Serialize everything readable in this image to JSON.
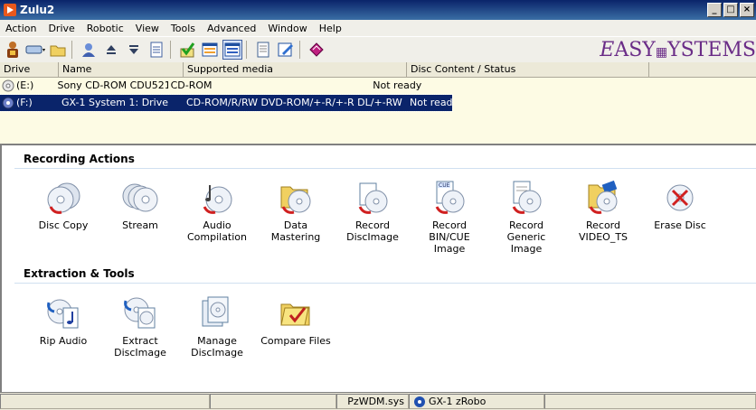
{
  "window": {
    "title": "Zulu2",
    "minimize": "_",
    "maximize": "□",
    "close": "×"
  },
  "menu": [
    "Action",
    "Drive",
    "Robotic",
    "View",
    "Tools",
    "Advanced",
    "Window",
    "Help"
  ],
  "brand": {
    "e": "E",
    "rest1": "ASY",
    "rest2": "YSTEMS"
  },
  "drive_table": {
    "headers": [
      "Drive",
      "Name",
      "Supported media",
      "Disc Content / Status"
    ],
    "rows": [
      {
        "drive": "(E:)",
        "name": "Sony CD-ROM CDU5212",
        "media": "CD-ROM",
        "status": "Not ready",
        "selected": false
      },
      {
        "drive": "(F:)",
        "name": "GX-1 System 1: Drive",
        "media": "CD-ROM/R/RW DVD-ROM/+-R/+-R DL/+-RW",
        "status": "Not ready",
        "selected": true
      }
    ]
  },
  "sections": {
    "recording": {
      "title": "Recording Actions",
      "items": [
        {
          "l1": "Disc Copy",
          "l2": ""
        },
        {
          "l1": "Stream",
          "l2": ""
        },
        {
          "l1": "Audio",
          "l2": "Compilation"
        },
        {
          "l1": "Data Mastering",
          "l2": ""
        },
        {
          "l1": "Record",
          "l2": "DiscImage"
        },
        {
          "l1": "Record",
          "l2": "BIN/CUE Image"
        },
        {
          "l1": "Record Generic",
          "l2": "Image"
        },
        {
          "l1": "Record",
          "l2": "VIDEO_TS"
        },
        {
          "l1": "Erase Disc",
          "l2": ""
        }
      ]
    },
    "extraction": {
      "title": "Extraction & Tools",
      "items": [
        {
          "l1": "Rip Audio",
          "l2": ""
        },
        {
          "l1": "Extract",
          "l2": "DiscImage"
        },
        {
          "l1": "Manage",
          "l2": "DiscImage"
        },
        {
          "l1": "Compare Files",
          "l2": ""
        }
      ]
    }
  },
  "statusbar": {
    "driver": "PzWDM.sys",
    "robot": "GX-1 zRobo"
  },
  "colors": {
    "title_bar": "#0a246a",
    "selection": "#0a246a",
    "drive_list_bg": "#fdfbe4",
    "brand": "#6a2c87"
  }
}
